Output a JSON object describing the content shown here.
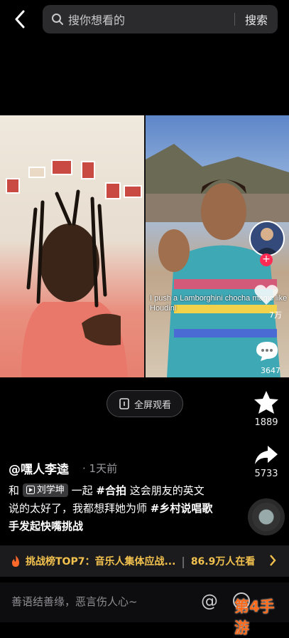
{
  "search": {
    "placeholder": "搜你想看的",
    "button_label": "搜索"
  },
  "video": {
    "overlay_caption": "I push a Lamborghini chocha magic like Houdini",
    "overlay_like_count": "7万",
    "overlay_comment_count": "3647"
  },
  "fullscreen": {
    "label": "全屏观看"
  },
  "actions": {
    "like_count": "1889",
    "share_count": "5733"
  },
  "post": {
    "author": "@嘿人李逵",
    "time": "· 1天前",
    "desc_prefix": "和",
    "mention": "刘学坤",
    "desc_mid": "一起",
    "tag1": "#合拍",
    "desc_text": "这会朋友的英文说的太好了，我都想拜她为师",
    "tag2": "#乡村说唱歌手发起快嘴挑战"
  },
  "challenge": {
    "text": "挑战榜TOP7：音乐人集体应战...",
    "viewers": "86.9万人在看"
  },
  "comment": {
    "placeholder": "善语结善缘，恶言伤人心~"
  },
  "watermark": "第4手游",
  "colors": {
    "accent_yellow": "#f2c14e",
    "plus_red": "#fe2c55"
  }
}
